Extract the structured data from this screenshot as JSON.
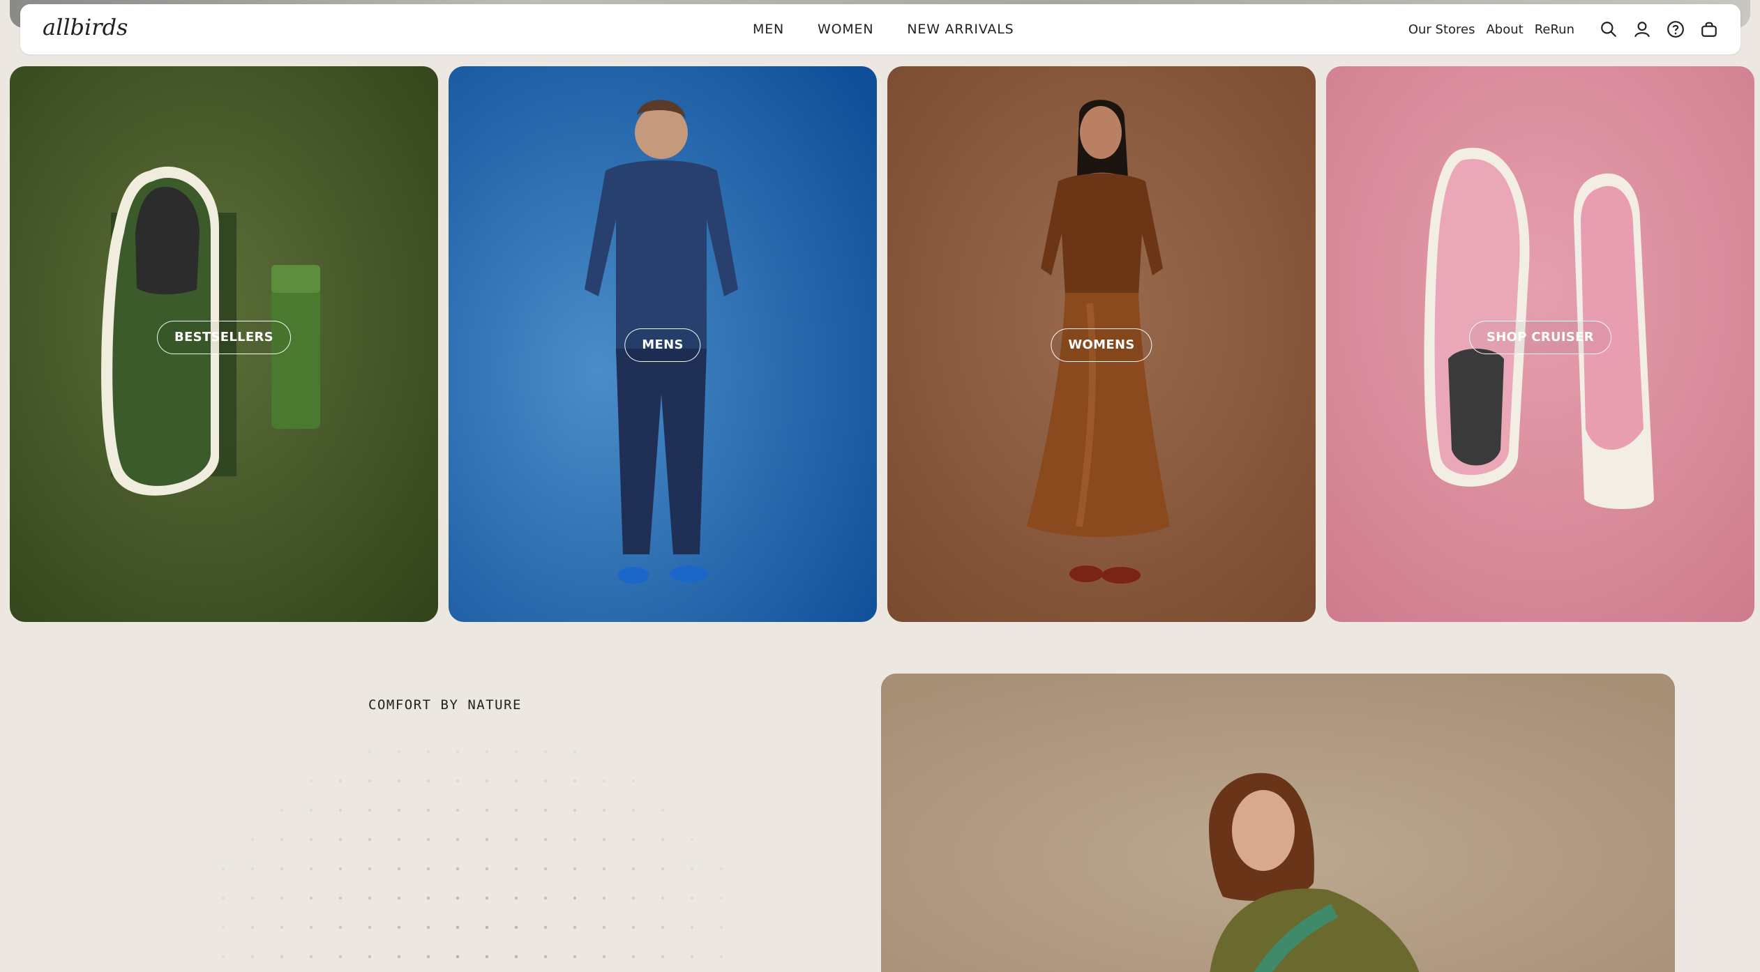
{
  "brand": {
    "logo_text": "allbirds"
  },
  "nav": {
    "primary": [
      {
        "label": "MEN"
      },
      {
        "label": "WOMEN"
      },
      {
        "label": "NEW ARRIVALS"
      }
    ],
    "secondary": [
      {
        "label": "Our Stores"
      },
      {
        "label": "About"
      },
      {
        "label": "ReRun"
      }
    ],
    "icons": [
      "search-icon",
      "account-icon",
      "help-icon",
      "cart-icon"
    ]
  },
  "tiles": [
    {
      "label": "BESTSELLERS",
      "color": "#4a5c2c"
    },
    {
      "label": "MENS",
      "color": "#2d6fb3"
    },
    {
      "label": "WOMENS",
      "color": "#8a5a3c"
    },
    {
      "label": "SHOP CRUISER",
      "color": "#d98c9c"
    }
  ],
  "section": {
    "heading": "COMFORT BY NATURE"
  },
  "colors": {
    "page_bg": "#ece8e1",
    "header_bg": "#ffffff",
    "text": "#212121"
  }
}
